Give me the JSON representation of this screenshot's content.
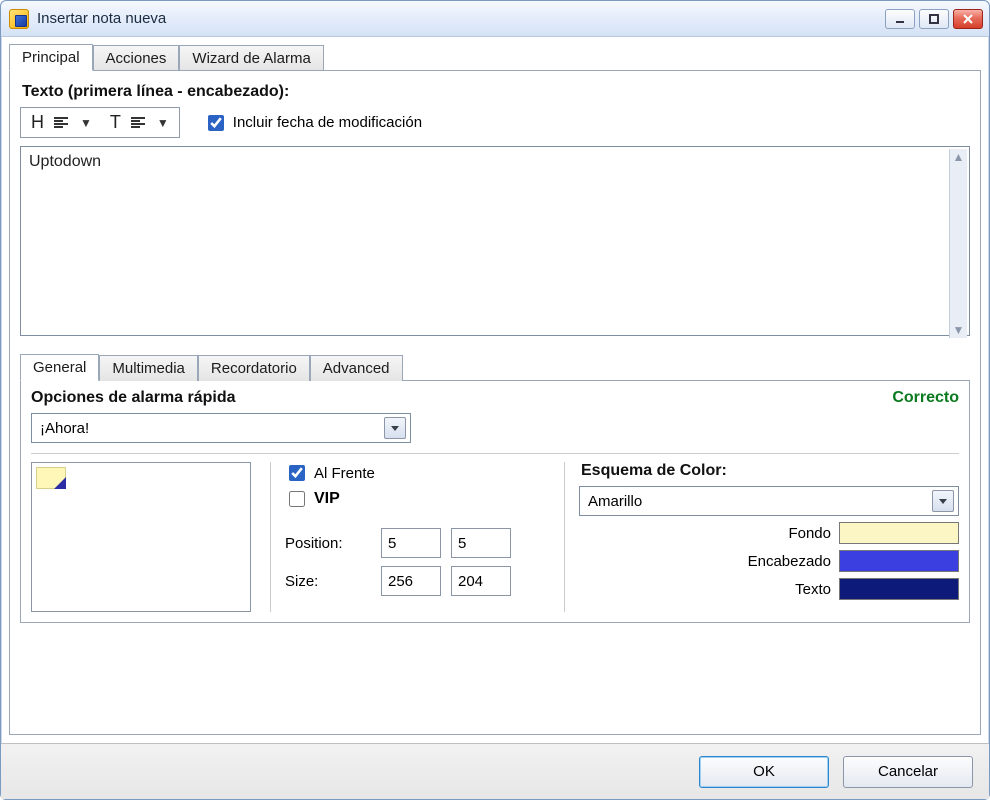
{
  "window": {
    "title": "Insertar nota nueva"
  },
  "main_tabs": {
    "principal": "Principal",
    "acciones": "Acciones",
    "wizard": "Wizard de Alarma"
  },
  "text_section": {
    "label": "Texto (primera línea - encabezado):",
    "include_mod_date": "Incluir fecha de modificación",
    "note_value": "Uptodown"
  },
  "inner_tabs": {
    "general": "General",
    "multimedia": "Multimedia",
    "recordatorio": "Recordatorio",
    "advanced": "Advanced"
  },
  "alarm": {
    "label": "Opciones de alarma rápida",
    "status": "Correcto",
    "selected": "¡Ahora!"
  },
  "options": {
    "al_frente": "Al Frente",
    "vip": "VIP",
    "position_label": "Position:",
    "size_label": "Size:",
    "pos_x": "5",
    "pos_y": "5",
    "size_w": "256",
    "size_h": "204"
  },
  "color_scheme": {
    "label": "Esquema de Color:",
    "selected": "Amarillo",
    "fondo_label": "Fondo",
    "encabezado_label": "Encabezado",
    "texto_label": "Texto",
    "fondo_hex": "#fbf6c3",
    "encabezado_hex": "#3b3fe0",
    "texto_hex": "#0d1a7a"
  },
  "footer": {
    "ok": "OK",
    "cancel": "Cancelar"
  }
}
